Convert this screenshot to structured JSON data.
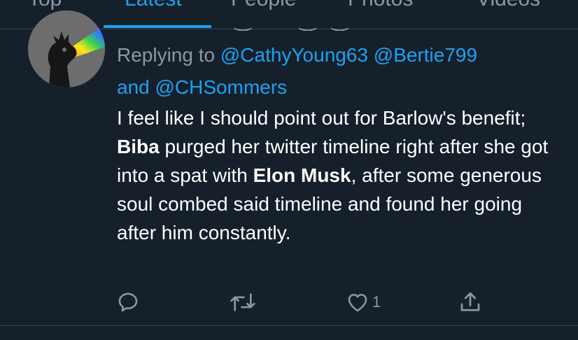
{
  "tabs": {
    "items": [
      {
        "label": "Top"
      },
      {
        "label": "Latest"
      },
      {
        "label": "People"
      },
      {
        "label": "Photos"
      },
      {
        "label": "Videos"
      }
    ],
    "active_index": 1
  },
  "tweet": {
    "replying": {
      "prefix": "Replying to",
      "mention_1": "@CathyYoung63",
      "mention_2": "@Bertie799",
      "conjunction": "and",
      "mention_3": "@CHSommers"
    },
    "body": {
      "part_1": "I feel like I should point out for Barlow's benefit; ",
      "bold_1": "Biba",
      "part_2": " purged her twitter timeline right after she got into a spat with ",
      "bold_2": "Elon Musk",
      "part_3": ", after some generous soul combed said timeline and found her going after him constantly."
    },
    "actions": {
      "reply_icon": "speech-bubble-icon",
      "retweet_icon": "retweet-icon",
      "like_icon": "heart-icon",
      "like_count": "1",
      "share_icon": "share-icon"
    }
  },
  "colors": {
    "background": "#15202b",
    "accent": "#1da1f2",
    "muted": "#8899a6",
    "divider": "#38444d"
  }
}
